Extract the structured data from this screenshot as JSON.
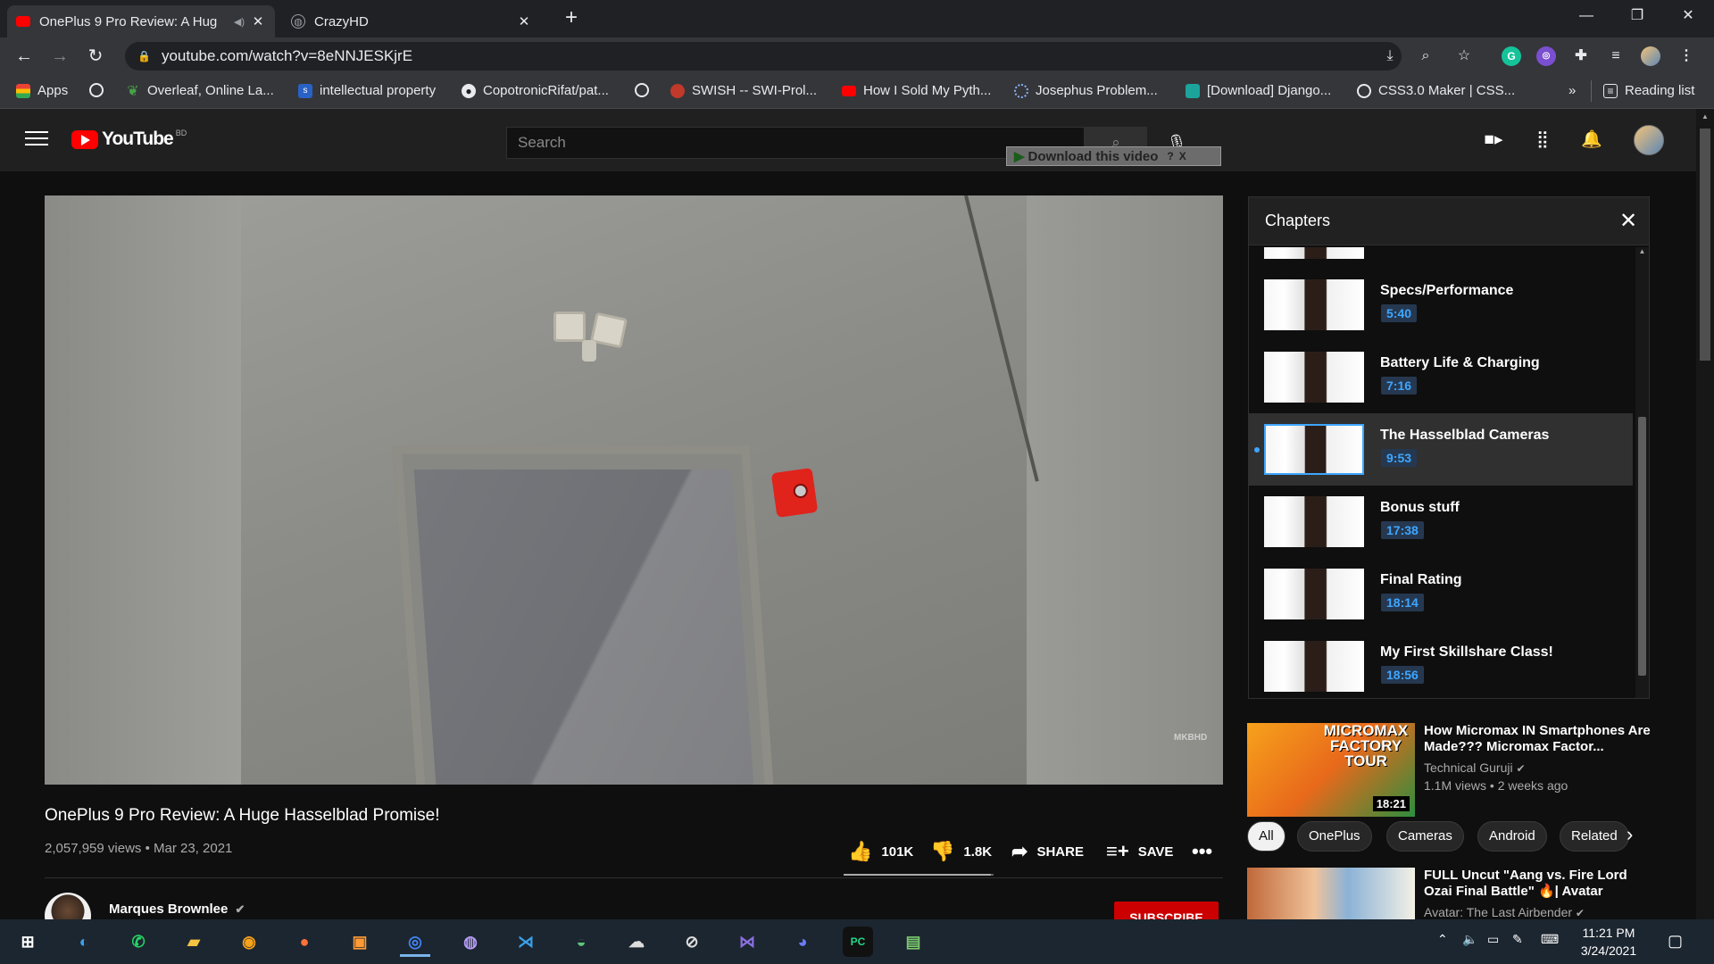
{
  "browser": {
    "tabs": [
      {
        "title": "OnePlus 9 Pro Review: A Hug",
        "favicon": "youtube-icon",
        "active": true
      },
      {
        "title": "CrazyHD",
        "favicon": "globe-icon",
        "active": false
      }
    ],
    "url": "youtube.com/watch?v=8eNNJESKjrE",
    "bookmarks": [
      "Apps",
      "Overleaf, Online La...",
      "intellectual property",
      "CopotronicRifat/pat...",
      "SWISH -- SWI-Prol...",
      "How I Sold My Pyth...",
      "Josephus Problem...",
      "[Download] Django...",
      "CSS3.0 Maker | CSS..."
    ],
    "bookmarks_overflow": "»",
    "reading_list": "Reading list"
  },
  "youtube": {
    "logo_text": "YouTube",
    "country_code": "BD",
    "search_placeholder": "Search",
    "download_overlay": "Download this video",
    "download_overlay_help": "?",
    "download_overlay_close": "X"
  },
  "video": {
    "title": "OnePlus 9 Pro Review: A Huge Hasselblad Promise!",
    "meta": "2,057,959 views • Mar 23, 2021",
    "watermark": "MKBHD",
    "likes": "101K",
    "dislikes": "1.8K",
    "share_label": "SHARE",
    "save_label": "SAVE",
    "like_ratio": 0.98,
    "channel_name": "Marques Brownlee",
    "subscribe_label": "SUBSCRIBE"
  },
  "chapters": {
    "title": "Chapters",
    "items": [
      {
        "title": "Specs/Performance",
        "time": "5:40",
        "active": false
      },
      {
        "title": "Battery Life & Charging",
        "time": "7:16",
        "active": false
      },
      {
        "title": "The Hasselblad Cameras",
        "time": "9:53",
        "active": true
      },
      {
        "title": "Bonus stuff",
        "time": "17:38",
        "active": false
      },
      {
        "title": "Final Rating",
        "time": "18:14",
        "active": false
      },
      {
        "title": "My First Skillshare Class!",
        "time": "18:56",
        "active": false
      }
    ]
  },
  "recommended": [
    {
      "title": "How Micromax IN Smartphones Are Made??? Micromax Factor...",
      "channel": "Technical Guruji",
      "meta": "1.1M views • 2 weeks ago",
      "duration": "18:21",
      "thumb_text": "MICROMAX FACTORY TOUR"
    },
    {
      "title": "FULL Uncut \"Aang vs. Fire Lord Ozai Final Battle\" 🔥| Avatar",
      "channel": "Avatar: The Last Airbender",
      "meta": "",
      "duration": ""
    }
  ],
  "chips": [
    "All",
    "OnePlus",
    "Cameras",
    "Android",
    "Related"
  ],
  "taskbar": {
    "time": "11:21 PM",
    "date": "3/24/2021"
  },
  "colors": {
    "youtube_red": "#ff0000",
    "chapter_time_blue": "#3ea6ff",
    "subscribe_red": "#cc0000"
  }
}
